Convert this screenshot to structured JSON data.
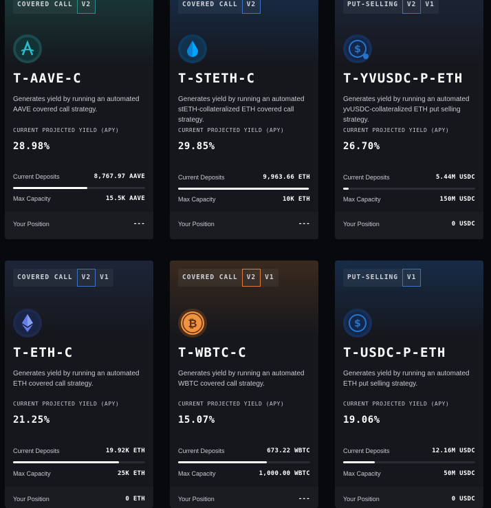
{
  "colors": {
    "aave": "#2ebac6",
    "steth": "#00a3ff",
    "usdc": "#2775ca",
    "eth": "#627eea",
    "wbtc": "#f09242",
    "tag_blue": "#3e73c4",
    "tag_amber": "#e07b3c",
    "tag_teal": "#2f8a8a"
  },
  "labels": {
    "apy_label": "CURRENT PROJECTED YIELD (APY)",
    "deposits_label": "Current Deposits",
    "capacity_label": "Max Capacity",
    "position_label": "Your Position"
  },
  "vaults": [
    {
      "tags": [
        "COVERED CALL",
        "V2"
      ],
      "icon": "aave-icon",
      "ticker": "T-AAVE-C",
      "description": "Generates yield by running an automated AAVE covered call strategy.",
      "apy": "28.98%",
      "deposits": "8,767.97 AAVE",
      "capacity": "15.5K AAVE",
      "fill": 0.56,
      "position": "---"
    },
    {
      "tags": [
        "COVERED CALL",
        "V2"
      ],
      "icon": "steth-icon",
      "ticker": "T-STETH-C",
      "description": "Generates yield by running an automated stETH-collateralized ETH covered call strategy.",
      "apy": "29.85%",
      "deposits": "9,963.66 ETH",
      "capacity": "10K ETH",
      "fill": 0.99,
      "position": "---"
    },
    {
      "tags": [
        "PUT-SELLING",
        "V2",
        "V1"
      ],
      "icon": "usdc-icon",
      "ticker": "T-YVUSDC-P-ETH",
      "description": "Generates yield by running an automated yvUSDC-collateralized ETH put selling strategy.",
      "apy": "26.70%",
      "deposits": "5.44M USDC",
      "capacity": "150M USDC",
      "fill": 0.04,
      "position": "0 USDC"
    },
    {
      "tags": [
        "COVERED CALL",
        "V2",
        "V1"
      ],
      "icon": "eth-icon",
      "ticker": "T-ETH-C",
      "description": "Generates yield by running an automated ETH covered call strategy.",
      "apy": "21.25%",
      "deposits": "19.92K ETH",
      "capacity": "25K ETH",
      "fill": 0.8,
      "position": "0 ETH"
    },
    {
      "tags": [
        "COVERED CALL",
        "V2",
        "V1"
      ],
      "icon": "bitcoin-icon",
      "ticker": "T-WBTC-C",
      "description": "Generates yield by running an automated WBTC covered call strategy.",
      "apy": "15.07%",
      "deposits": "673.22 WBTC",
      "capacity": "1,000.00 WBTC",
      "fill": 0.67,
      "position": "---"
    },
    {
      "tags": [
        "PUT-SELLING",
        "V1"
      ],
      "icon": "usdc-icon",
      "ticker": "T-USDC-P-ETH",
      "description": "Generates yield by running an automated ETH put selling strategy.",
      "apy": "19.06%",
      "deposits": "12.16M USDC",
      "capacity": "50M USDC",
      "fill": 0.24,
      "position": "0 USDC"
    }
  ]
}
